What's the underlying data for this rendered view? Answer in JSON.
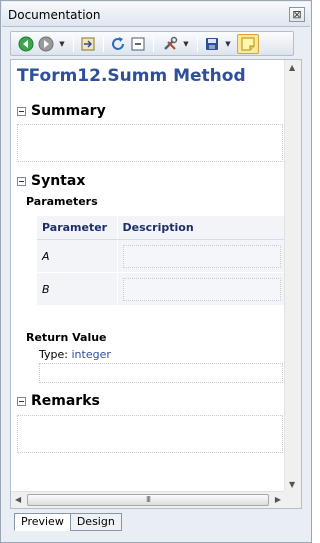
{
  "window": {
    "title": "Documentation",
    "close_glyph": "⊠"
  },
  "toolbar": {
    "buttons": [
      {
        "name": "back-icon",
        "glyph": "⮜",
        "color": "#2f9a3a"
      },
      {
        "name": "forward-icon",
        "glyph": "⮞",
        "color": "#8a8a8a"
      },
      {
        "name": "export-icon",
        "glyph": "⇥",
        "color": "#6a5a2a"
      },
      {
        "name": "refresh-icon",
        "glyph": "⟳",
        "color": "#2b6cc4"
      },
      {
        "name": "collapse-all-icon",
        "glyph": "⊟",
        "color": "#3a4b66"
      },
      {
        "name": "tools-icon",
        "glyph": "⚒",
        "color": "#5a6470"
      },
      {
        "name": "save-icon",
        "glyph": "💾",
        "color": "#2b4f9a"
      },
      {
        "name": "note-icon",
        "glyph": "✎",
        "color": "#c9a300"
      }
    ]
  },
  "doc": {
    "title": "TForm12.Summ Method",
    "sections": {
      "summary": "Summary",
      "syntax": "Syntax",
      "remarks": "Remarks"
    },
    "parameters_heading": "Parameters",
    "param_table": {
      "headers": [
        "Parameter",
        "Description"
      ],
      "rows": [
        {
          "name": "A",
          "description": ""
        },
        {
          "name": "B",
          "description": ""
        }
      ]
    },
    "return_value_heading": "Return Value",
    "type_label": "Type:",
    "type_value": "integer"
  },
  "tabs": [
    "Preview",
    "Design"
  ],
  "scrollbar": {
    "thumb_grip": "III"
  },
  "colors": {
    "title_blue": "#2e4f9a",
    "header_blue": "#1d2f6a"
  }
}
